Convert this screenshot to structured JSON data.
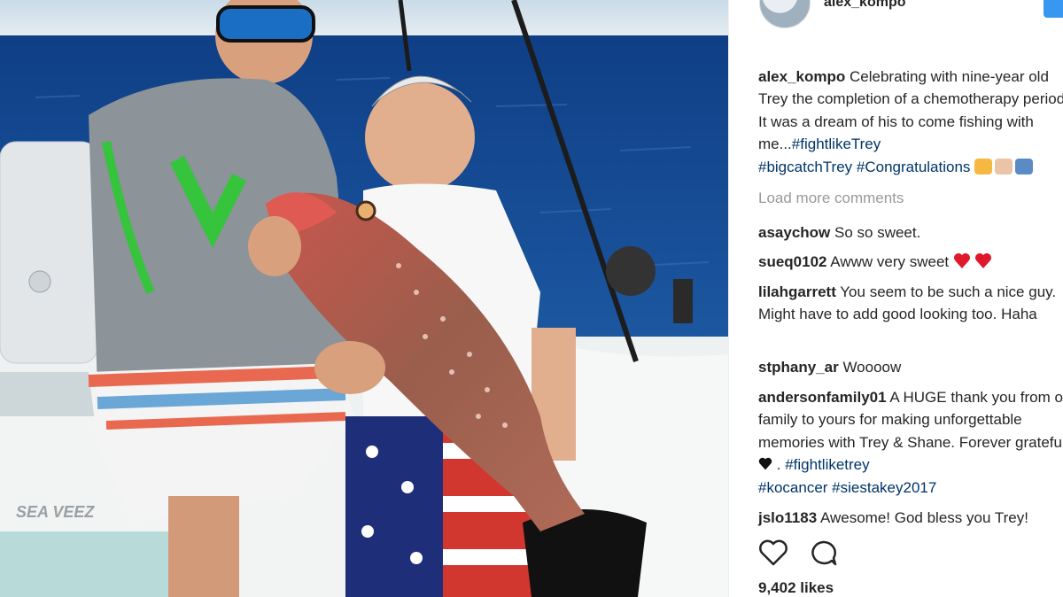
{
  "post": {
    "username": "alex_kompo",
    "caption_user": "alex_kompo",
    "caption_text": "Celebrating with nine-year old Trey the completion of a chemotherapy period! It was a dream of his to come fishing with me...",
    "caption_tags": [
      "#fightlikeTrey",
      "#bigcatchTrey",
      "#Congratulations"
    ],
    "load_more": "Load more comments",
    "likes": "9,402 likes"
  },
  "comments": [
    {
      "user": "asaychow",
      "text": "So so sweet."
    },
    {
      "user": "sueq0102",
      "text": "Awww very sweet"
    },
    {
      "user": "lilahgarrett",
      "text": "You seem to be such a nice guy. Might have to add good looking too. Haha"
    },
    {
      "user": "stphany_ar",
      "text": "Woooow"
    },
    {
      "user": "andersonfamily01",
      "text": "A HUGE thank you from our family to yours for making unforgettable memories with Trey & Shane. Forever grateful",
      "text2": ".",
      "tags": [
        "#fightliketrey",
        "#kocancer",
        "#siestakey2017"
      ]
    },
    {
      "user": "jslo1183",
      "text": "Awesome! God bless you Trey!"
    }
  ],
  "photo": {
    "boat_brand": "SEA VEEZ"
  },
  "icons": {
    "like": "heart-icon",
    "comment": "comment-icon",
    "heart_emoji": "red-heart-icon",
    "black_heart": "black-heart-icon"
  },
  "colors": {
    "link": "#003569",
    "muted": "#999999",
    "text": "#262626",
    "heart": "#ed4956"
  }
}
